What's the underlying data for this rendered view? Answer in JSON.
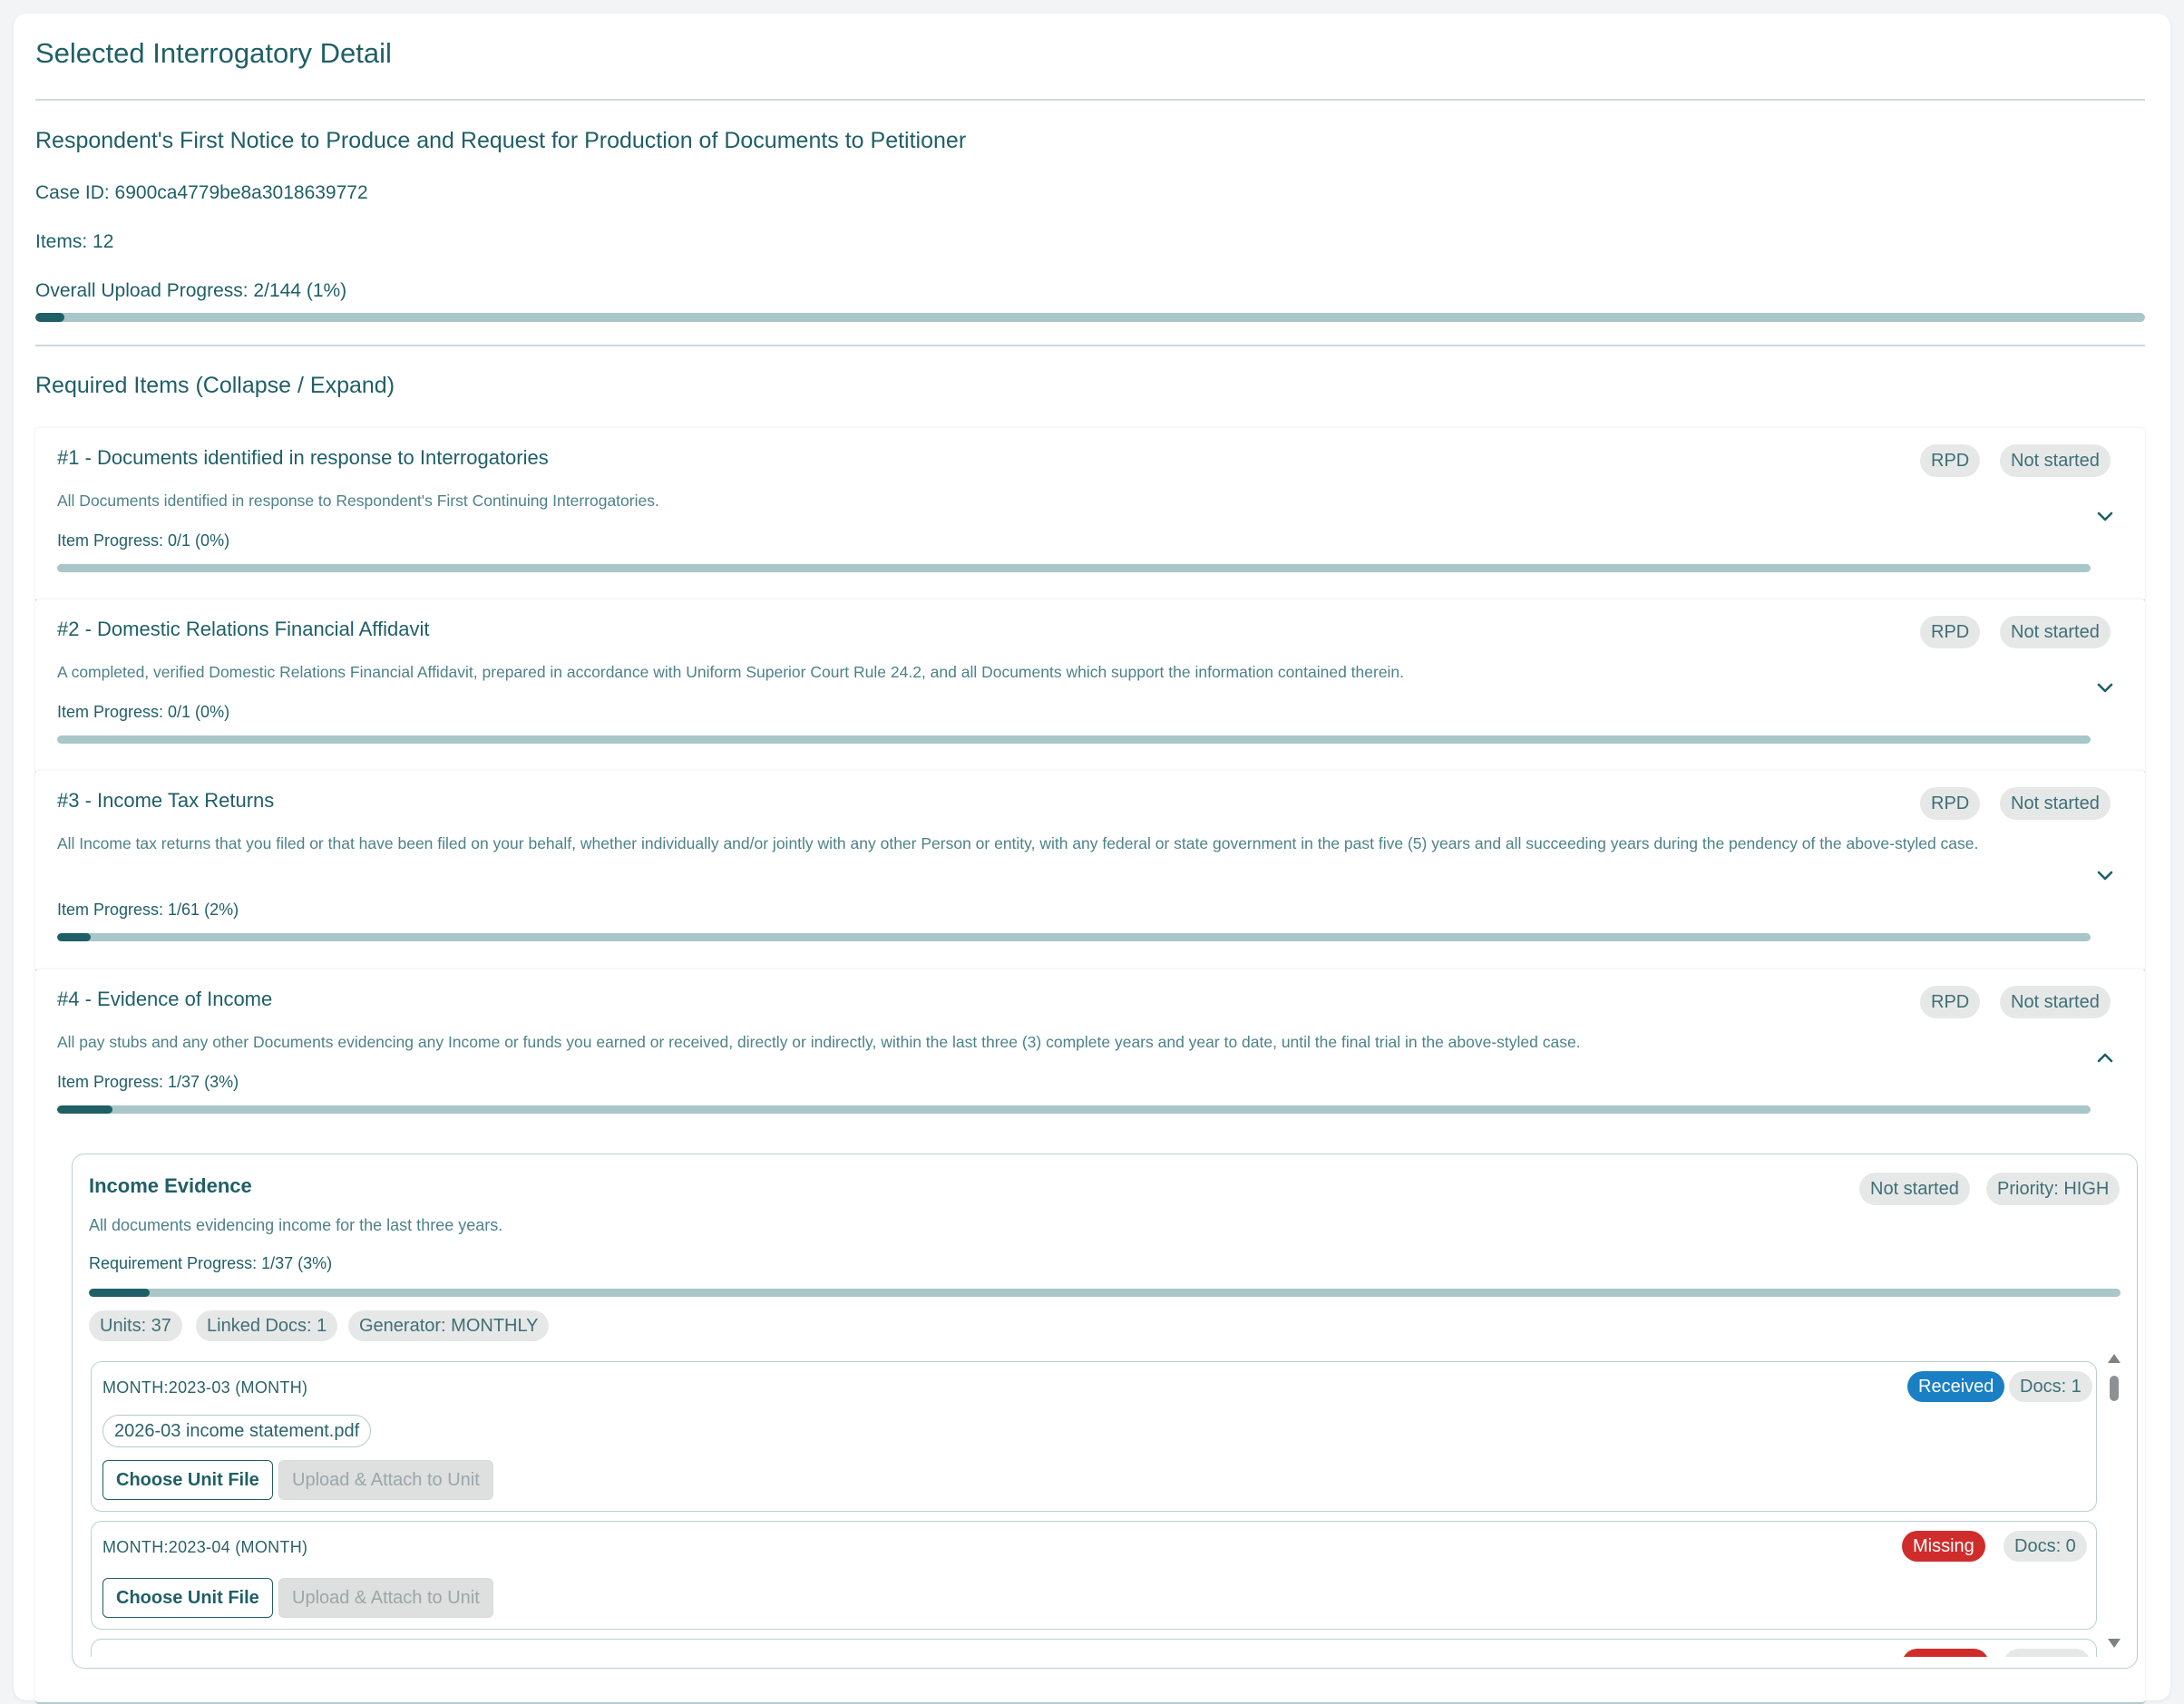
{
  "panel": {
    "title": "Selected Interrogatory Detail",
    "subtitle": "Respondent's First Notice to Produce and Request for Production of Documents to Petitioner",
    "case_id": "Case ID: 6900ca4779be8a3018639772",
    "items_count": "Items: 12",
    "overall_progress_label": "Overall Upload Progress: 2/144 (1%)",
    "overall_progress_fraction": 0.0139,
    "section_heading": "Required Items (Collapse / Expand)"
  },
  "items": [
    {
      "title": "#1 - Documents identified in response to Interrogatories",
      "description": "All Documents identified in response to Respondent's First Continuing Interrogatories.",
      "progress_label": "Item Progress: 0/1 (0%)",
      "progress_fraction": 0,
      "tag": "RPD",
      "status": "Not started",
      "expanded": false
    },
    {
      "title": "#2 - Domestic Relations Financial Affidavit",
      "description": "A completed, verified Domestic Relations Financial Affidavit, prepared in accordance with Uniform Superior Court Rule 24.2, and all Documents which support the information contained therein.",
      "progress_label": "Item Progress: 0/1 (0%)",
      "progress_fraction": 0,
      "tag": "RPD",
      "status": "Not started",
      "expanded": false
    },
    {
      "title": "#3 - Income Tax Returns",
      "description": "All Income tax returns that you filed or that have been filed on your behalf, whether individually and/or jointly with any other Person or entity, with any federal or state government in the past five (5) years and all succeeding years during the pendency of the above-styled case.",
      "progress_label": "Item Progress: 1/61 (2%)",
      "progress_fraction": 0.0164,
      "tag": "RPD",
      "status": "Not started",
      "expanded": false
    },
    {
      "title": "#4 - Evidence of Income",
      "description": "All pay stubs and any other Documents evidencing any Income or funds you earned or received, directly or indirectly, within the last three (3) complete years and year to date, until the final trial in the above-styled case.",
      "progress_label": "Item Progress: 1/37 (3%)",
      "progress_fraction": 0.027,
      "tag": "RPD",
      "status": "Not started",
      "expanded": true
    }
  ],
  "requirement": {
    "title": "Income Evidence",
    "description": "All documents evidencing income for the last three years.",
    "progress_label": "Requirement Progress: 1/37 (3%)",
    "progress_fraction": 0.03,
    "status": "Not started",
    "priority": "Priority: HIGH",
    "units_chip": "Units: 37",
    "linked_docs_chip": "Linked Docs: 1",
    "generator_chip": "Generator: MONTHLY",
    "units": [
      {
        "label": "MONTH:2023-03 (MONTH)",
        "status": "Received",
        "status_color": "#1a7fc4",
        "docs": "Docs: 1",
        "file": "2026-03 income statement.pdf",
        "choose_label": "Choose Unit File",
        "upload_label": "Upload & Attach to Unit"
      },
      {
        "label": "MONTH:2023-04 (MONTH)",
        "status": "Missing",
        "status_color": "#d12c2c",
        "docs": "Docs: 0",
        "choose_label": "Choose Unit File",
        "upload_label": "Upload & Attach to Unit"
      }
    ]
  },
  "colors": {
    "accent": "#1f5f66",
    "track": "#a9c6c9",
    "received": "#1a7fc4",
    "missing": "#d12c2c"
  }
}
